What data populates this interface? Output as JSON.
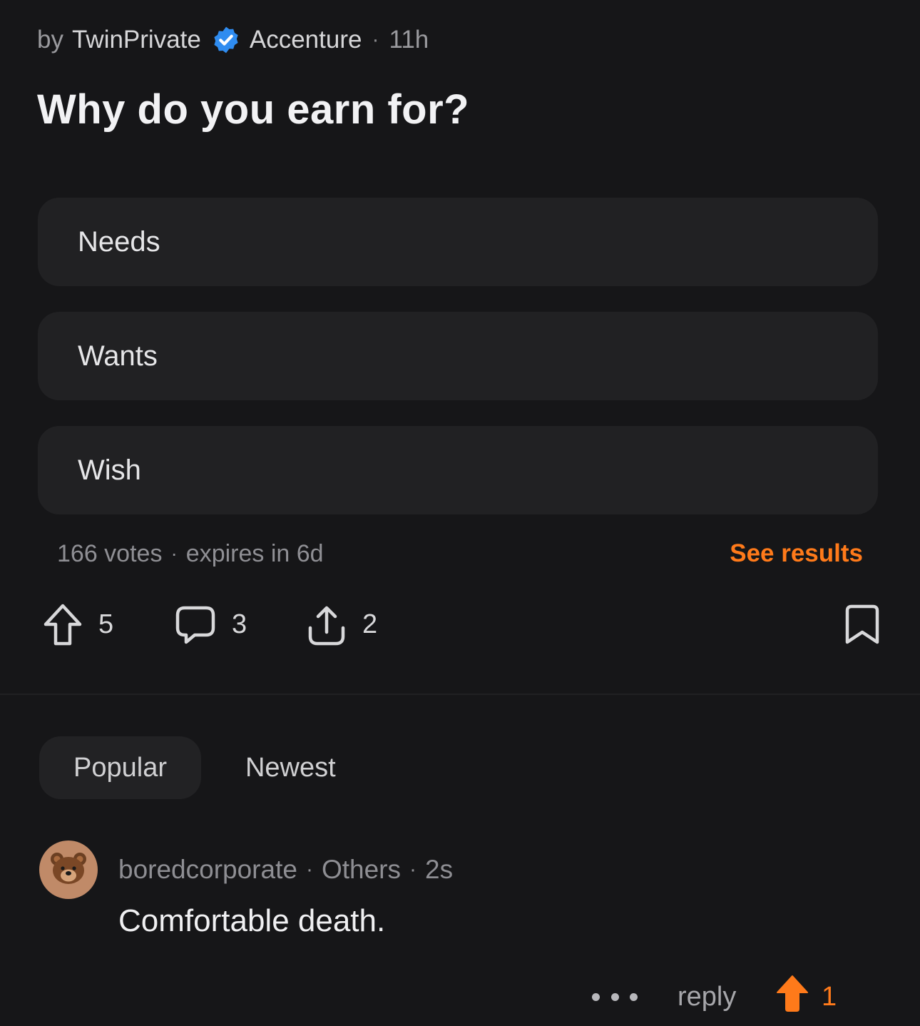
{
  "post": {
    "by_prefix": "by",
    "author": "TwinPrivate",
    "company": "Accenture",
    "age": "11h",
    "title": "Why do you earn for?"
  },
  "poll": {
    "options": [
      "Needs",
      "Wants",
      "Wish"
    ],
    "votes": "166 votes",
    "expires": "expires in 6d",
    "see_results_label": "See results"
  },
  "actions": {
    "upvote_count": "5",
    "comment_count": "3",
    "share_count": "2",
    "upvote_icon": "arrow-up-outline-icon",
    "comment_icon": "speech-bubble-icon",
    "share_icon": "share-upload-icon",
    "bookmark_icon": "bookmark-icon"
  },
  "sort_tabs": {
    "popular": "Popular",
    "newest": "Newest",
    "selected": "Popular"
  },
  "comment": {
    "username": "boredcorporate",
    "company": "Others",
    "age": "2s",
    "text": "Comfortable death.",
    "avatar_icon": "bear-face-icon",
    "reply_label": "reply",
    "upvote_count": "1",
    "upvoted": true
  },
  "colors": {
    "background": "#161618",
    "card": "#212123",
    "accent": "#ff7a1a",
    "verified": "#2f8cf0",
    "avatar_bg": "#c08a68"
  }
}
